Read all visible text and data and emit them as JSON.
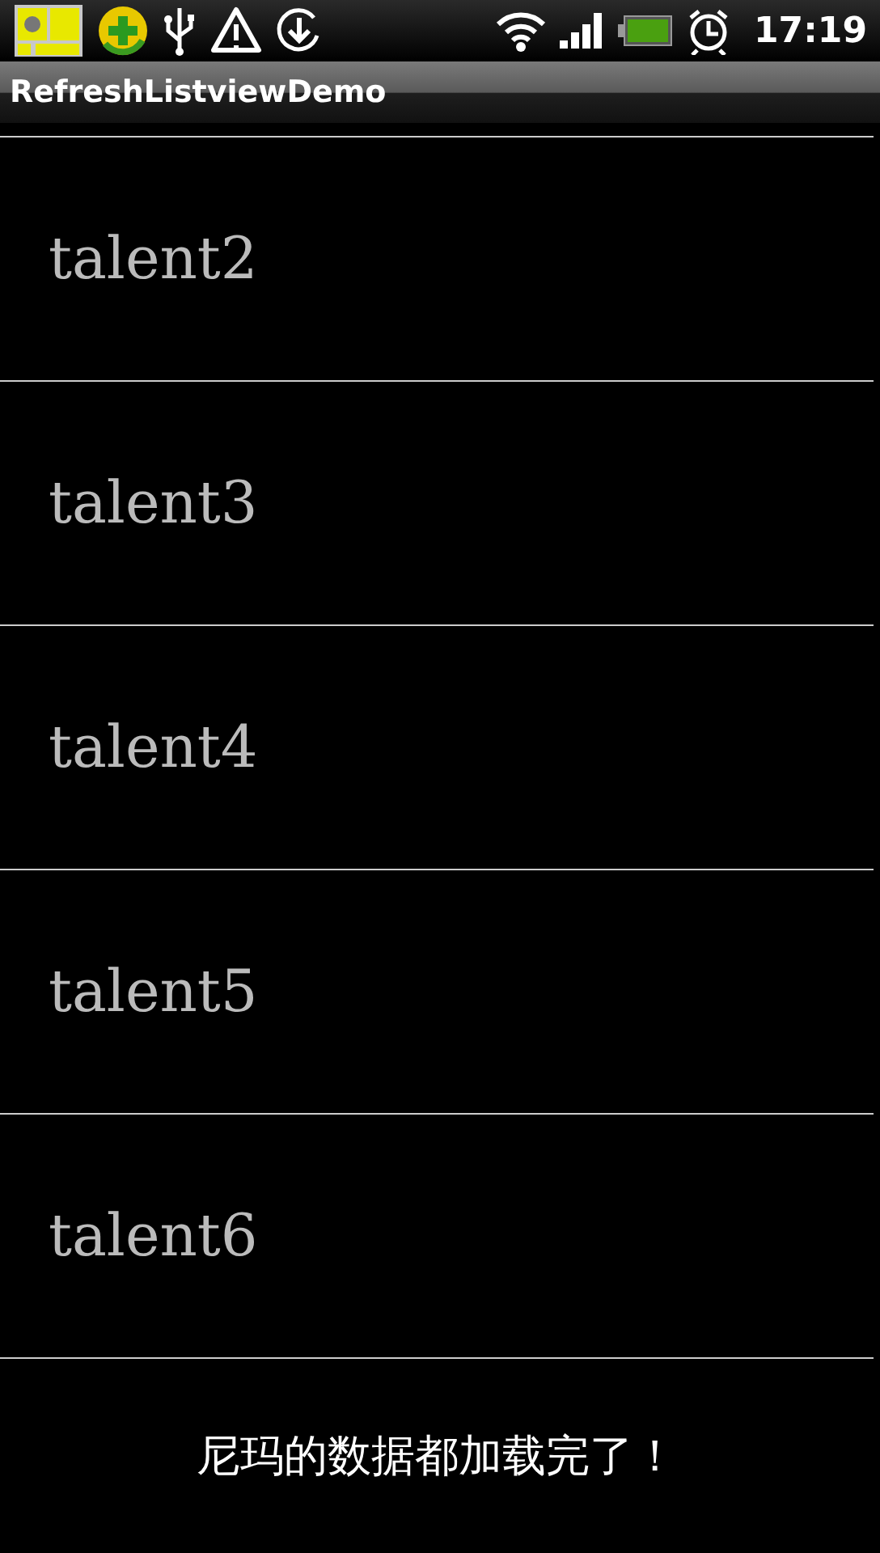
{
  "status_bar": {
    "time": "17:19"
  },
  "window": {
    "title": "RefreshListviewDemo"
  },
  "list": {
    "items": [
      {
        "label": "talent2"
      },
      {
        "label": "talent3"
      },
      {
        "label": "talent4"
      },
      {
        "label": "talent5"
      },
      {
        "label": "talent6"
      }
    ]
  },
  "footer": {
    "message": "尼玛的数据都加载完了！"
  }
}
